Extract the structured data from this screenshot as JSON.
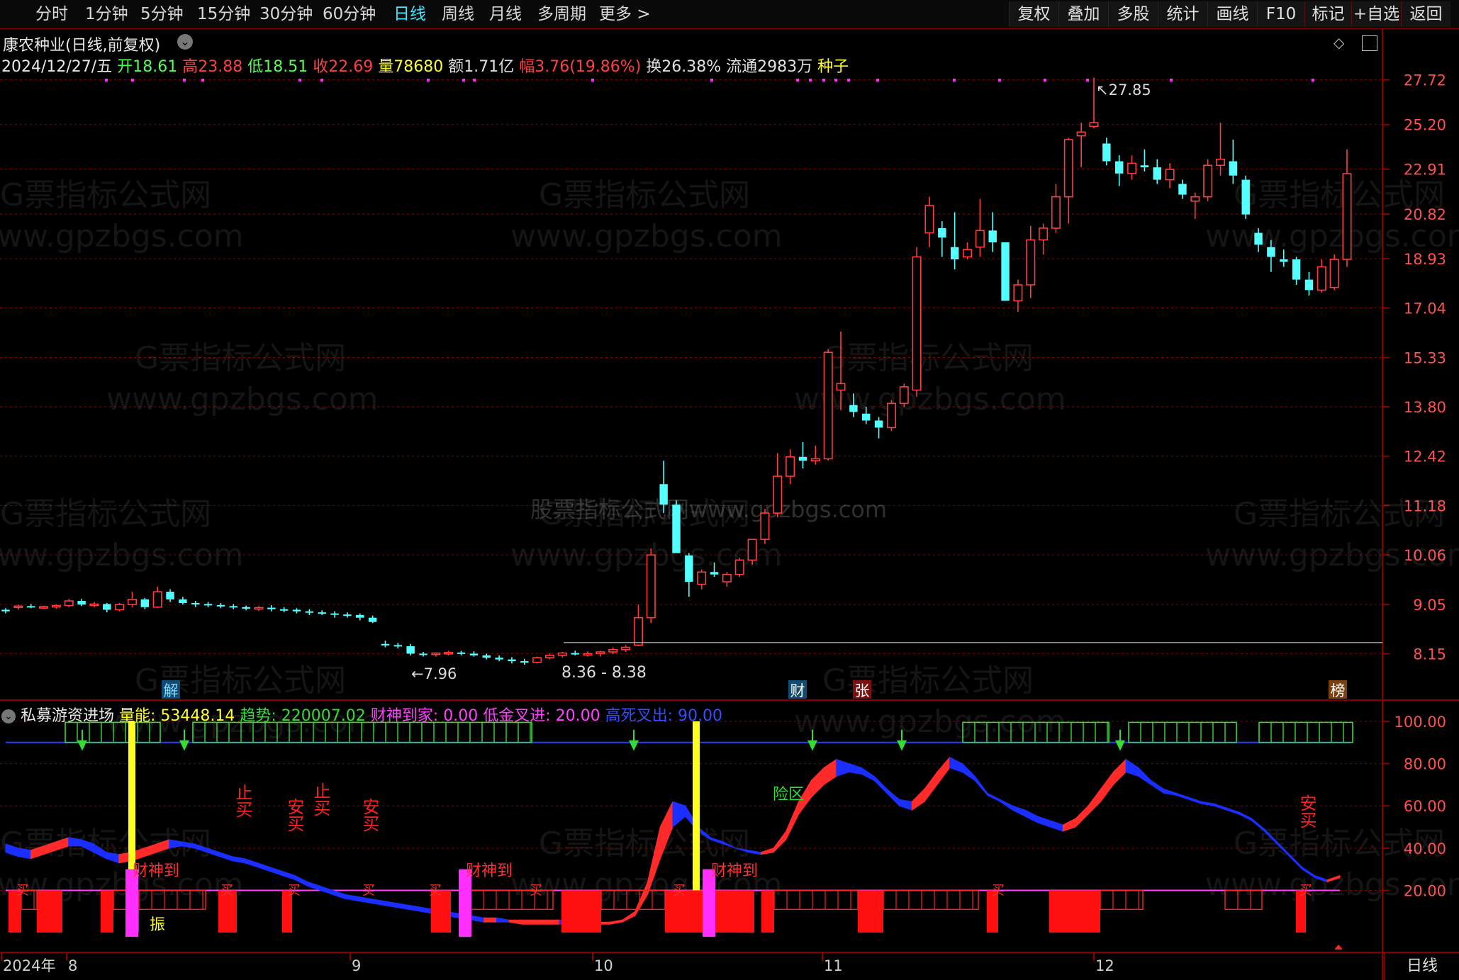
{
  "toolbar": {
    "left": [
      "分时",
      "1分钟",
      "5分钟",
      "15分钟",
      "30分钟",
      "60分钟",
      "日线",
      "周线",
      "月线",
      "多周期",
      "更多 >"
    ],
    "active": "日线",
    "right": [
      "复权",
      "叠加",
      "多股",
      "统计",
      "画线",
      "F10",
      "标记",
      "+自选",
      "返回"
    ]
  },
  "header": {
    "title": "康农种业(日线,前复权)",
    "date": "2024/12/27/五",
    "open_label": "开",
    "open": "18.61",
    "high_label": "高",
    "high": "23.88",
    "low_label": "低",
    "low": "18.51",
    "close_label": "收",
    "close": "22.69",
    "vol_label": "量",
    "vol": "78680",
    "amount": "额1.71亿",
    "range": "幅3.76(19.86%)",
    "turnover": "换26.38%",
    "float": "流通2983万",
    "seed": "种子"
  },
  "indicator_header": {
    "name": "私募游资进场",
    "vol_energy": "量能: 53448.14",
    "trend": "趋势: 220007.02",
    "caishen": "财神到家: 0.00",
    "low_gold": "低金叉进: 20.00",
    "high_dead": "高死叉出: 90.00"
  },
  "watermarks": [
    "G票指标公式网",
    "www.gpzbgs.com",
    "股票指标公式网www.gpzbgs.com"
  ],
  "footer": {
    "period": "日线"
  },
  "colors": {
    "up": "#ff3c3c",
    "down": "#54ffff",
    "grid": "#8a0000",
    "axis_text": "#ff5050",
    "blue": "#1a2fff",
    "green": "#33dd33",
    "yellow": "#ffff20",
    "magenta": "#ff30ff"
  },
  "chart_data": [
    {
      "type": "candlestick",
      "title": "康农种业(日线,前复权)",
      "y_ticks": [
        27.72,
        25.2,
        22.91,
        20.82,
        18.93,
        17.04,
        15.33,
        13.8,
        12.42,
        11.18,
        10.06,
        9.05,
        8.15
      ],
      "y_scale": "log",
      "x_ticks": [
        "2024年",
        "8",
        "9",
        "10",
        "11",
        "12"
      ],
      "annotations": {
        "high_marker": "27.85",
        "low_marker": "7.96",
        "range_label": "8.36 - 8.38"
      },
      "event_tags": [
        "解",
        "财",
        "张",
        "榜"
      ],
      "candles": [
        [
          8.95,
          8.98,
          8.88,
          8.92
        ],
        [
          9.0,
          9.05,
          8.95,
          9.02
        ],
        [
          9.02,
          9.06,
          8.98,
          9.0
        ],
        [
          9.0,
          9.03,
          8.96,
          9.01
        ],
        [
          9.01,
          9.05,
          8.97,
          9.03
        ],
        [
          9.03,
          9.16,
          9.0,
          9.12
        ],
        [
          9.12,
          9.16,
          9.02,
          9.05
        ],
        [
          9.05,
          9.1,
          9.0,
          9.06
        ],
        [
          9.06,
          9.08,
          8.9,
          8.95
        ],
        [
          8.95,
          9.08,
          8.92,
          9.05
        ],
        [
          9.05,
          9.3,
          9.0,
          9.15
        ],
        [
          9.15,
          9.18,
          8.96,
          9.0
        ],
        [
          9.0,
          9.4,
          8.98,
          9.3
        ],
        [
          9.3,
          9.35,
          9.1,
          9.15
        ],
        [
          9.15,
          9.2,
          9.05,
          9.08
        ],
        [
          9.08,
          9.12,
          9.0,
          9.06
        ],
        [
          9.06,
          9.1,
          9.0,
          9.04
        ],
        [
          9.04,
          9.08,
          8.98,
          9.02
        ],
        [
          9.02,
          9.06,
          8.96,
          9.0
        ],
        [
          9.0,
          9.03,
          8.94,
          8.97
        ],
        [
          8.97,
          9.02,
          8.93,
          8.99
        ],
        [
          8.99,
          9.04,
          8.92,
          8.96
        ],
        [
          8.96,
          9.0,
          8.9,
          8.95
        ],
        [
          8.95,
          8.98,
          8.88,
          8.92
        ],
        [
          8.92,
          8.96,
          8.85,
          8.9
        ],
        [
          8.9,
          8.94,
          8.85,
          8.88
        ],
        [
          8.88,
          8.92,
          8.8,
          8.86
        ],
        [
          8.86,
          8.9,
          8.8,
          8.85
        ],
        [
          8.85,
          8.88,
          8.75,
          8.8
        ],
        [
          8.8,
          8.84,
          8.7,
          8.72
        ],
        [
          8.32,
          8.38,
          8.26,
          8.3
        ],
        [
          8.3,
          8.34,
          8.24,
          8.28
        ],
        [
          8.28,
          8.32,
          8.12,
          8.15
        ],
        [
          8.15,
          8.18,
          8.1,
          8.14
        ],
        [
          8.14,
          8.17,
          8.1,
          8.16
        ],
        [
          8.16,
          8.2,
          8.12,
          8.17
        ],
        [
          8.17,
          8.2,
          8.12,
          8.15
        ],
        [
          8.15,
          8.19,
          8.1,
          8.12
        ],
        [
          8.12,
          8.15,
          8.05,
          8.08
        ],
        [
          8.08,
          8.12,
          8.02,
          8.05
        ],
        [
          8.05,
          8.09,
          7.98,
          8.02
        ],
        [
          8.02,
          8.06,
          7.96,
          8.0
        ],
        [
          8.0,
          8.1,
          7.98,
          8.08
        ],
        [
          8.08,
          8.15,
          8.05,
          8.12
        ],
        [
          8.12,
          8.18,
          8.08,
          8.16
        ],
        [
          8.16,
          8.2,
          8.12,
          8.14
        ],
        [
          8.14,
          8.19,
          8.1,
          8.15
        ],
        [
          8.15,
          8.2,
          8.1,
          8.18
        ],
        [
          8.18,
          8.26,
          8.14,
          8.22
        ],
        [
          8.22,
          8.3,
          8.18,
          8.26
        ],
        [
          8.3,
          9.05,
          8.28,
          8.8
        ],
        [
          8.8,
          10.2,
          8.7,
          10.06
        ],
        [
          11.7,
          12.3,
          11.0,
          11.2
        ],
        [
          11.2,
          11.3,
          10.1,
          10.1
        ],
        [
          10.05,
          10.1,
          9.2,
          9.5
        ],
        [
          9.45,
          9.75,
          9.35,
          9.7
        ],
        [
          9.7,
          9.9,
          9.6,
          9.65
        ],
        [
          9.5,
          9.7,
          9.4,
          9.65
        ],
        [
          9.65,
          10.0,
          9.6,
          9.95
        ],
        [
          9.95,
          10.4,
          9.85,
          10.4
        ],
        [
          10.4,
          11.1,
          10.3,
          11.0
        ],
        [
          11.0,
          12.5,
          10.9,
          11.9
        ],
        [
          11.9,
          12.6,
          11.7,
          12.4
        ],
        [
          12.4,
          12.8,
          12.1,
          12.3
        ],
        [
          12.3,
          12.7,
          12.2,
          12.35
        ],
        [
          12.35,
          15.6,
          12.3,
          15.5
        ],
        [
          14.3,
          16.2,
          13.7,
          14.5
        ],
        [
          13.85,
          14.2,
          13.5,
          13.65
        ],
        [
          13.6,
          13.8,
          13.3,
          13.4
        ],
        [
          13.4,
          13.5,
          12.9,
          13.2
        ],
        [
          13.2,
          14.0,
          13.1,
          13.9
        ],
        [
          13.9,
          14.5,
          13.8,
          14.4
        ],
        [
          14.3,
          19.4,
          14.1,
          19.0
        ],
        [
          20.0,
          21.6,
          19.4,
          21.2
        ],
        [
          20.2,
          20.5,
          19.0,
          19.8
        ],
        [
          19.4,
          20.9,
          18.5,
          18.9
        ],
        [
          19.0,
          19.6,
          18.9,
          19.3
        ],
        [
          19.4,
          21.5,
          19.0,
          20.1
        ],
        [
          20.1,
          20.9,
          19.2,
          19.6
        ],
        [
          19.6,
          19.6,
          17.5,
          17.3
        ],
        [
          17.3,
          18.1,
          16.9,
          17.9
        ],
        [
          17.9,
          20.3,
          17.4,
          19.7
        ],
        [
          19.7,
          20.4,
          19.1,
          20.2
        ],
        [
          20.2,
          22.2,
          20.0,
          21.6
        ],
        [
          21.6,
          24.5,
          20.4,
          24.4
        ],
        [
          24.6,
          25.3,
          23.0,
          24.8
        ],
        [
          25.1,
          27.85,
          25.0,
          25.3
        ],
        [
          24.2,
          24.5,
          23.1,
          23.3
        ],
        [
          23.3,
          23.6,
          22.1,
          22.7
        ],
        [
          22.7,
          23.6,
          22.4,
          23.2
        ],
        [
          23.1,
          23.9,
          22.8,
          23.0
        ],
        [
          23.0,
          23.4,
          22.2,
          22.4
        ],
        [
          22.4,
          23.2,
          22.0,
          22.9
        ],
        [
          22.2,
          22.4,
          21.5,
          21.7
        ],
        [
          21.4,
          21.8,
          20.6,
          21.6
        ],
        [
          21.6,
          23.4,
          21.4,
          23.1
        ],
        [
          23.1,
          25.3,
          22.6,
          23.4
        ],
        [
          23.3,
          24.4,
          22.2,
          22.6
        ],
        [
          22.4,
          22.6,
          20.6,
          20.8
        ],
        [
          20.0,
          20.2,
          19.2,
          19.5
        ],
        [
          19.4,
          19.7,
          18.4,
          19.0
        ],
        [
          18.9,
          19.3,
          18.6,
          18.8
        ],
        [
          18.9,
          19.0,
          17.9,
          18.1
        ],
        [
          18.1,
          18.4,
          17.5,
          17.7
        ],
        [
          17.7,
          18.9,
          17.6,
          18.6
        ],
        [
          17.8,
          19.1,
          17.7,
          18.9
        ],
        [
          18.9,
          23.9,
          18.6,
          22.69
        ]
      ]
    },
    {
      "type": "line",
      "title": "私募游资进场",
      "y_ticks": [
        100.0,
        80.0,
        60.0,
        40.0,
        20.0
      ],
      "levels": {
        "low_gold_cross": 20.0,
        "high_dead_cross": 90.0
      },
      "series": [
        {
          "name": "趋势",
          "values": [
            38,
            36,
            35,
            37,
            39,
            41,
            41,
            38,
            35,
            33,
            34,
            36,
            38,
            40,
            41,
            40,
            38,
            36,
            34,
            33,
            31,
            29,
            27,
            25,
            22,
            20,
            18,
            16,
            15,
            14,
            13,
            12,
            11,
            10,
            9,
            8,
            7,
            6,
            5,
            5,
            5,
            4,
            4,
            4,
            4,
            4,
            4,
            4,
            4,
            5,
            8,
            18,
            35,
            50,
            55,
            48,
            44,
            42,
            40,
            38,
            37,
            38,
            44,
            56,
            64,
            70,
            74,
            76,
            75,
            72,
            66,
            60,
            58,
            62,
            70,
            78,
            76,
            72,
            65,
            62,
            58,
            55,
            52,
            50,
            48,
            50,
            56,
            62,
            70,
            76,
            74,
            70,
            66,
            65,
            63,
            61,
            60,
            58,
            56,
            53,
            48,
            42,
            36,
            30,
            26,
            24,
            26
          ]
        },
        {
          "name": "量能",
          "values": [
            42,
            40,
            39,
            41,
            43,
            45,
            44,
            42,
            38,
            37,
            38,
            40,
            42,
            44,
            43,
            42,
            40,
            38,
            36,
            35,
            33,
            31,
            29,
            27,
            24,
            22,
            20,
            18,
            17,
            16,
            15,
            14,
            13,
            12,
            11,
            10,
            9,
            8,
            7,
            7,
            6,
            6,
            6,
            6,
            6,
            5,
            5,
            5,
            5,
            6,
            10,
            24,
            50,
            62,
            60,
            50,
            45,
            43,
            40,
            39,
            38,
            40,
            48,
            62,
            72,
            78,
            82,
            80,
            78,
            74,
            68,
            63,
            62,
            68,
            76,
            83,
            80,
            74,
            66,
            63,
            60,
            58,
            55,
            53,
            51,
            54,
            60,
            68,
            76,
            82,
            78,
            72,
            68,
            66,
            64,
            62,
            61,
            59,
            57,
            54,
            49,
            43,
            37,
            31,
            27,
            25,
            27
          ]
        }
      ],
      "signals": [
        "买",
        "止买",
        "安买",
        "财神到",
        "振",
        "险区"
      ]
    }
  ]
}
